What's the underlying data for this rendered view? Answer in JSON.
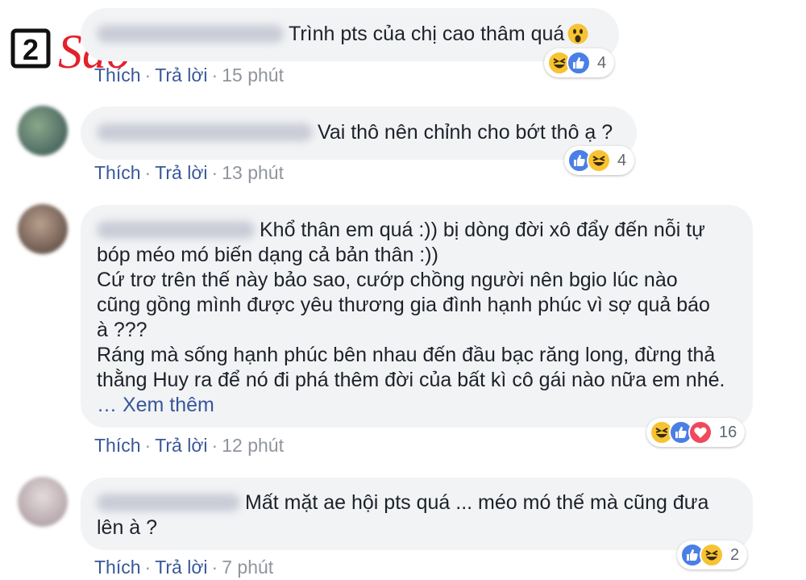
{
  "brand": {
    "logo_num": "2",
    "logo_text": "Sao"
  },
  "comments": [
    {
      "lines": [
        "Trình pts của chị cao thâm quá"
      ],
      "show_emoji_inline": true,
      "actions": {
        "like": "Thích",
        "reply": "Trả lời",
        "time": "15 phút"
      },
      "reactions": {
        "icons": [
          "haha",
          "like"
        ],
        "count": "4"
      }
    },
    {
      "lines": [
        "Vai thô nên chỉnh cho bớt thô ạ ?"
      ],
      "actions": {
        "like": "Thích",
        "reply": "Trả lời",
        "time": "13 phút"
      },
      "reactions": {
        "icons": [
          "like",
          "haha"
        ],
        "count": "4"
      }
    },
    {
      "lines": [
        "Khổ thân em quá :)) bị dòng đời xô đẩy đến nỗi tự",
        "bóp méo mó biến dạng cả bản thân :))",
        "Cứ trơ trên thế này bảo sao, cướp chồng người nên bgio lúc nào",
        "cũng gồng mình được yêu thương gia đình hạnh phúc vì sợ quả báo",
        "à ???",
        "Ráng mà sống hạnh phúc bên nhau đến đầu bạc răng long, đừng thả",
        "thằng Huy ra để nó đi phá thêm đời của bất kì cô gái nào nữa em nhé."
      ],
      "see_more": "… Xem thêm",
      "actions": {
        "like": "Thích",
        "reply": "Trả lời",
        "time": "12 phút"
      },
      "reactions": {
        "icons": [
          "haha",
          "like",
          "love"
        ],
        "count": "16"
      }
    },
    {
      "lines": [
        "Mất mặt ae hội pts quá ... méo mó thế mà cũng đưa",
        "lên à ?"
      ],
      "actions": {
        "like": "Thích",
        "reply": "Trả lời",
        "time": "7 phút"
      },
      "reactions": {
        "icons": [
          "like",
          "haha"
        ],
        "count": "2"
      }
    }
  ],
  "colors": {
    "link": "#385898",
    "meta": "#90949c",
    "bubble": "#f2f3f5",
    "like": "#4a7fe6",
    "haha": "#f7c332",
    "love": "#f0485d",
    "logo_red": "#e4202b"
  }
}
